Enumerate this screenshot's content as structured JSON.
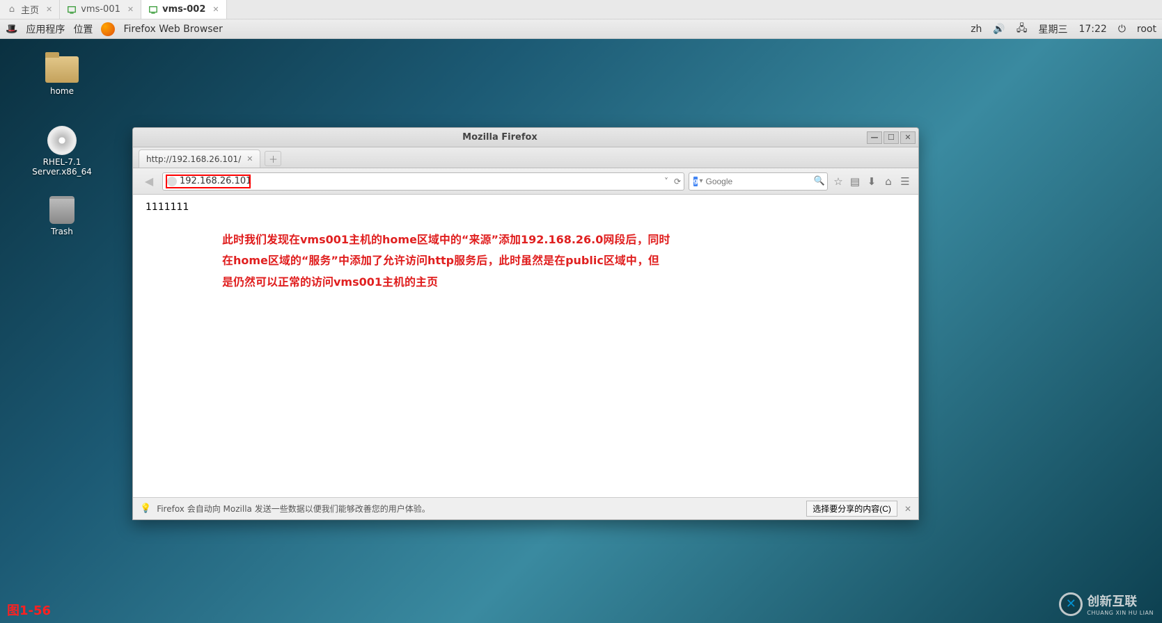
{
  "host_tabs": {
    "home": "主页",
    "vm1": "vms-001",
    "vm2": "vms-002"
  },
  "panel": {
    "apps": "应用程序",
    "places": "位置",
    "firefox": "Firefox Web Browser",
    "lang": "zh",
    "day": "星期三",
    "time": "17:22",
    "user": "root"
  },
  "desktop_icons": {
    "home": "home",
    "rhel": "RHEL-7.1 Server.x86_64",
    "trash": "Trash"
  },
  "firefox": {
    "title": "Mozilla Firefox",
    "tab_label": "http://192.168.26.101/",
    "url": "192.168.26.101",
    "search_placeholder": "Google",
    "status_msg": "Firefox 会自动向 Mozilla 发送一些数据以便我们能够改善您的用户体验。",
    "status_btn": "选择要分享的内容(C)"
  },
  "page": {
    "body_text": "1111111",
    "annotation_l1": "此时我们发现在vms001主机的home区域中的“来源”添加192.168.26.0网段后，同时",
    "annotation_l2": "在home区域的“服务”中添加了允许访问http服务后，此时虽然是在public区域中，但",
    "annotation_l3": "是仍然可以正常的访问vms001主机的主页"
  },
  "fig_label": "图1-56",
  "watermark": {
    "zh": "创新互联",
    "en": "CHUANG XIN HU LIAN"
  }
}
